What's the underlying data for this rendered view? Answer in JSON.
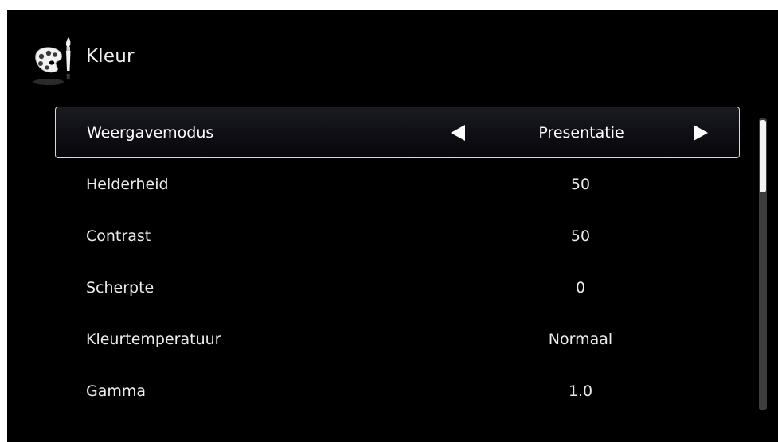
{
  "header": {
    "title": "Kleur",
    "icon": "palette-brush-icon"
  },
  "menu": {
    "items": [
      {
        "label": "Weergavemodus",
        "value": "Presentatie",
        "selected": true
      },
      {
        "label": "Helderheid",
        "value": "50"
      },
      {
        "label": "Contrast",
        "value": "50"
      },
      {
        "label": "Scherpte",
        "value": "0"
      },
      {
        "label": "Kleurtemperatuur",
        "value": "Normaal"
      },
      {
        "label": "Gamma",
        "value": "1.0"
      }
    ]
  },
  "scroll": {
    "visible_fraction": 0.25,
    "position_fraction": 0.0
  },
  "colors": {
    "background": "#000000",
    "text": "#ececec",
    "selection_border": "#d9d9d9",
    "divider": "#6e8ca5"
  }
}
